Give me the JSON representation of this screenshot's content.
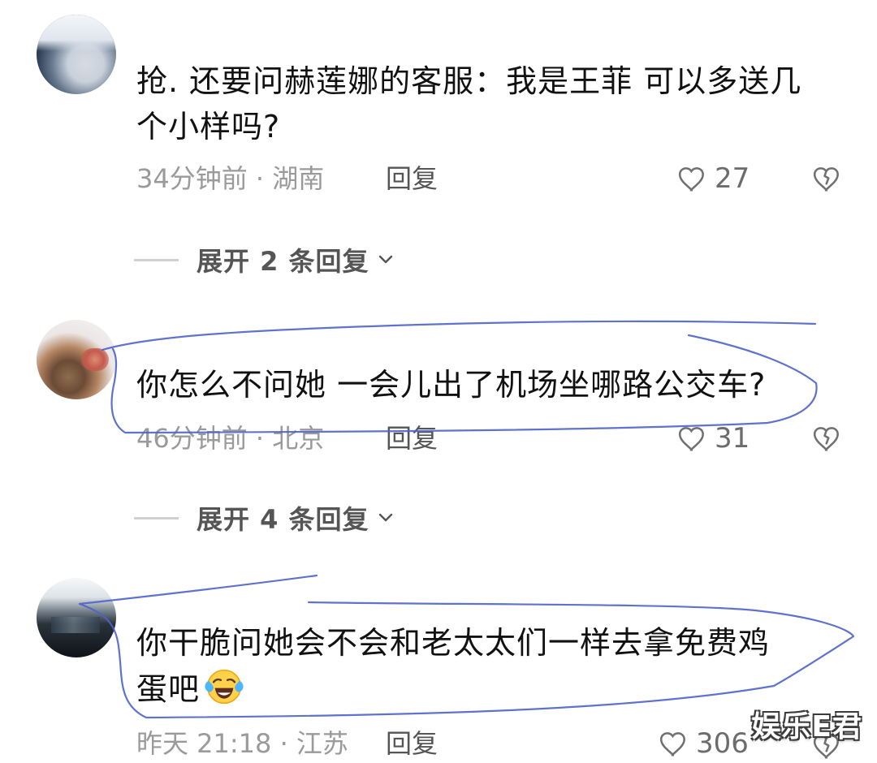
{
  "comments": [
    {
      "text": "抢. 还要问赫莲娜的客服：我是王菲 可以多送几\n个小样吗?",
      "time": "34分钟前",
      "location": "湖南",
      "reply_label": "回复",
      "likes": "27"
    },
    {
      "text": "你怎么不问她 一会儿出了机场坐哪路公交车?",
      "time": "46分钟前",
      "location": "北京",
      "reply_label": "回复",
      "likes": "31"
    },
    {
      "text": "你干脆问她会不会和老太太们一样去拿免费鸡\n蛋吧",
      "time": "昨天 21:18",
      "location": "江苏",
      "reply_label": "回复",
      "likes": "306"
    }
  ],
  "expand_replies": [
    "展开 2 条回复",
    "展开 4 条回复"
  ],
  "watermark": "娱乐E君",
  "colors": {
    "annotation_blue": "#4e63c9",
    "muted_text": "#9a9a9a",
    "action_text": "#555555"
  },
  "icons": {
    "like": "heart-outline-icon",
    "dislike": "broken-heart-icon",
    "expand": "chevron-down-icon",
    "emoji": "laughing-crying-face-icon"
  }
}
